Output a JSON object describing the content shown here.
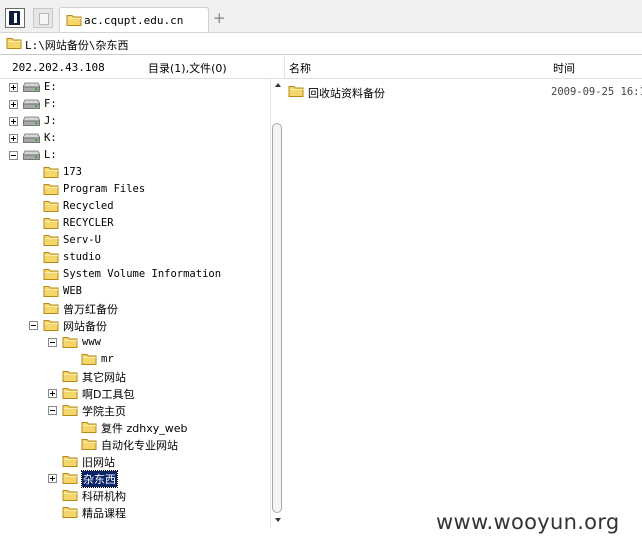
{
  "window": {
    "tab_title": "ac.cqupt.edu.cn",
    "add_tab_glyph": "+"
  },
  "address": {
    "path": "L:\\网站备份\\杂东西"
  },
  "header": {
    "ip": "202.202.43.108",
    "dir_count": "目录(1),文件(0)",
    "col_name": "名称",
    "col_time": "时间"
  },
  "tree": [
    {
      "label": "E:",
      "kind": "drive",
      "expander": "plus",
      "depth": 0
    },
    {
      "label": "F:",
      "kind": "drive",
      "expander": "plus",
      "depth": 0
    },
    {
      "label": "J:",
      "kind": "drive",
      "expander": "plus",
      "depth": 0
    },
    {
      "label": "K:",
      "kind": "drive",
      "expander": "plus",
      "depth": 0
    },
    {
      "label": "L:",
      "kind": "drive",
      "expander": "minus",
      "depth": 0
    },
    {
      "label": "173",
      "kind": "folder",
      "expander": "none",
      "depth": 1
    },
    {
      "label": "Program Files",
      "kind": "folder",
      "expander": "none",
      "depth": 1
    },
    {
      "label": "Recycled",
      "kind": "folder",
      "expander": "none",
      "depth": 1
    },
    {
      "label": "RECYCLER",
      "kind": "folder",
      "expander": "none",
      "depth": 1
    },
    {
      "label": "Serv-U",
      "kind": "folder",
      "expander": "none",
      "depth": 1
    },
    {
      "label": "studio",
      "kind": "folder",
      "expander": "none",
      "depth": 1
    },
    {
      "label": "System Volume Information",
      "kind": "folder",
      "expander": "none",
      "depth": 1
    },
    {
      "label": "WEB",
      "kind": "folder",
      "expander": "none",
      "depth": 1
    },
    {
      "label": "曾万红备份",
      "kind": "folder",
      "expander": "none",
      "depth": 1
    },
    {
      "label": "网站备份",
      "kind": "folder",
      "expander": "minus",
      "depth": 1
    },
    {
      "label": "www",
      "kind": "folder",
      "expander": "minus",
      "depth": 2
    },
    {
      "label": "mr",
      "kind": "folder",
      "expander": "none",
      "depth": 3
    },
    {
      "label": "其它网站",
      "kind": "folder",
      "expander": "none",
      "depth": 2
    },
    {
      "label": "啊D工具包",
      "kind": "folder",
      "expander": "plus",
      "depth": 2
    },
    {
      "label": "学院主页",
      "kind": "folder",
      "expander": "minus",
      "depth": 2
    },
    {
      "label": "复件 zdhxy_web",
      "kind": "folder",
      "expander": "none",
      "depth": 3
    },
    {
      "label": "自动化专业网站",
      "kind": "folder",
      "expander": "none",
      "depth": 3
    },
    {
      "label": "旧网站",
      "kind": "folder",
      "expander": "none",
      "depth": 2
    },
    {
      "label": "杂东西",
      "kind": "folder",
      "expander": "plus",
      "depth": 2,
      "selected": true
    },
    {
      "label": "科研机构",
      "kind": "folder",
      "expander": "none",
      "depth": 2
    },
    {
      "label": "精品课程",
      "kind": "folder",
      "expander": "none",
      "depth": 2
    }
  ],
  "files": [
    {
      "name": "回收站资料备份",
      "time": "2009-09-25 16:1"
    }
  ],
  "watermark": "www.wooyun.org",
  "colors": {
    "folder_fill": "#f5d66b",
    "folder_stroke": "#b58a17",
    "selection": "#0a246a"
  }
}
